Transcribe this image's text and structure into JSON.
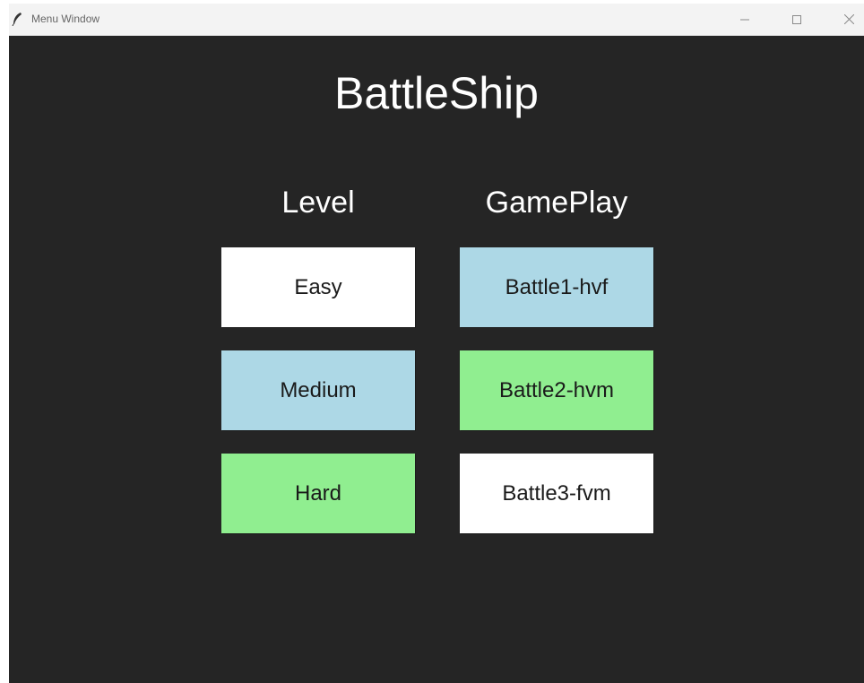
{
  "window": {
    "title": "Menu Window",
    "icon": "feather-icon",
    "controls": {
      "minimize_icon": "minimize-icon",
      "maximize_icon": "maximize-icon",
      "close_icon": "close-icon"
    }
  },
  "app": {
    "title": "BattleShip",
    "background_color": "#252525"
  },
  "level": {
    "heading": "Level",
    "buttons": [
      {
        "label": "Easy",
        "color": "#ffffff"
      },
      {
        "label": "Medium",
        "color": "#add8e6"
      },
      {
        "label": "Hard",
        "color": "#90ee90"
      }
    ]
  },
  "gameplay": {
    "heading": "GamePlay",
    "buttons": [
      {
        "label": "Battle1-hvf",
        "color": "#add8e6"
      },
      {
        "label": "Battle2-hvm",
        "color": "#90ee90"
      },
      {
        "label": "Battle3-fvm",
        "color": "#ffffff"
      }
    ]
  }
}
